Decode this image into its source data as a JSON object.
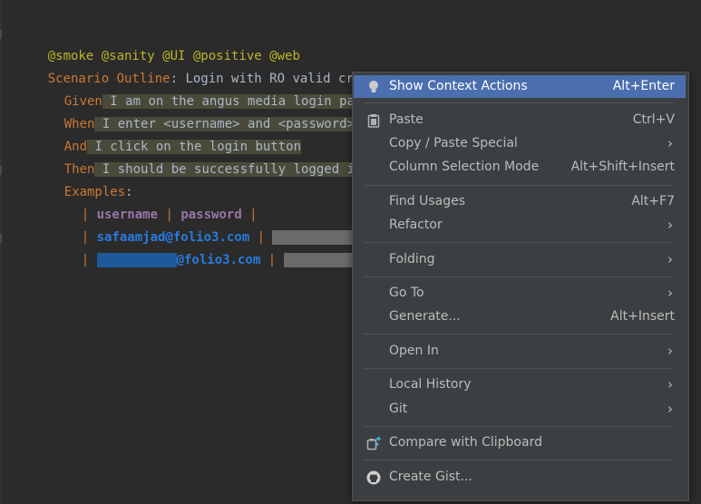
{
  "editor": {
    "tags_line": "@smoke @sanity @UI @positive @web",
    "scenario_keyword": "Scenario Outline",
    "scenario_colon": ":",
    "scenario_title": " Login with RO valid credentials",
    "steps": [
      {
        "keyword": "Given",
        "text": " I am on the angus media login pag"
      },
      {
        "keyword": "When",
        "text": " I enter <username> and <password>"
      },
      {
        "keyword": "And",
        "text": " I click on the login button"
      },
      {
        "keyword": "Then",
        "text": " I should be successfully logged in"
      }
    ],
    "examples_keyword": "Examples",
    "examples_colon": ":",
    "table": {
      "headers": [
        "username",
        "password"
      ],
      "row1_username": "safaamjad@folio3.com",
      "row2_username_suffix": "@folio3.com"
    }
  },
  "context_menu": {
    "items": {
      "show_context_actions": {
        "label": "Show Context Actions",
        "shortcut": "Alt+Enter",
        "icon": "lightbulb-icon"
      },
      "paste": {
        "label": "Paste",
        "shortcut": "Ctrl+V",
        "icon": "clipboard-icon"
      },
      "copy_paste_special": {
        "label": "Copy / Paste Special"
      },
      "column_selection_mode": {
        "label": "Column Selection Mode",
        "shortcut": "Alt+Shift+Insert"
      },
      "find_usages": {
        "label": "Find Usages",
        "shortcut": "Alt+F7"
      },
      "refactor": {
        "label": "Refactor"
      },
      "folding": {
        "label": "Folding"
      },
      "go_to": {
        "label": "Go To"
      },
      "generate": {
        "label": "Generate...",
        "shortcut": "Alt+Insert"
      },
      "open_in": {
        "label": "Open In"
      },
      "local_history": {
        "label": "Local History"
      },
      "git": {
        "label": "Git"
      },
      "compare_with_clipboard": {
        "label": "Compare with Clipboard",
        "icon": "compare-icon"
      },
      "create_gist": {
        "label": "Create Gist...",
        "icon": "github-icon"
      }
    },
    "submenu_arrow": "›"
  },
  "colors": {
    "editor_bg": "#2b2b2b",
    "menu_bg": "#3c3f41",
    "selection": "#4b6eaf",
    "tag": "#bbb529",
    "keyword": "#cc7832",
    "table_header": "#9876aa",
    "table_cell": "#287bde"
  }
}
